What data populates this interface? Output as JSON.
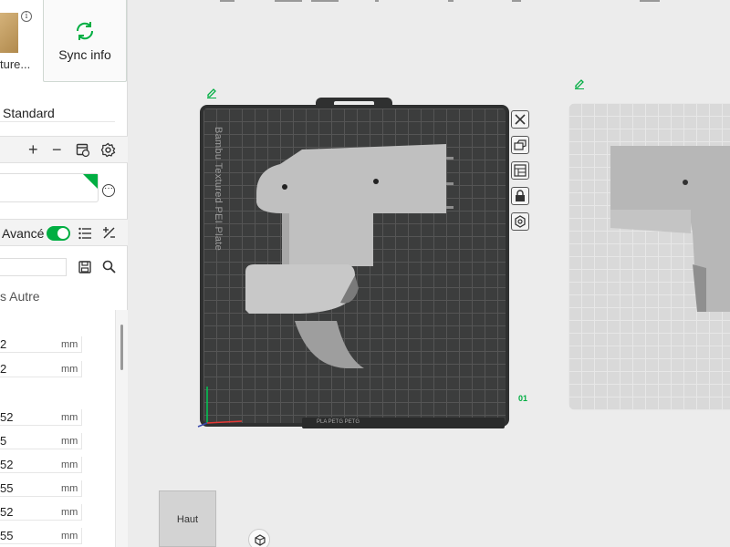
{
  "left_panel": {
    "plate_thumb_label": "ture...",
    "info_icon": "info-icon",
    "sync_button_label": "Sync info",
    "process_preset": "Standard",
    "mode_label": "Avancé",
    "tabs_text": "s   Autre",
    "rows": [
      {
        "value": "2",
        "unit": "mm"
      },
      {
        "value": "2",
        "unit": "mm"
      },
      {
        "value": "52",
        "unit": "mm"
      },
      {
        "value": "5",
        "unit": "mm"
      },
      {
        "value": "52",
        "unit": "mm"
      },
      {
        "value": "55",
        "unit": "mm"
      },
      {
        "value": "52",
        "unit": "mm"
      },
      {
        "value": "55",
        "unit": "mm"
      }
    ]
  },
  "viewport": {
    "plate_name": "Bambu Textured PEI Plate",
    "plate_number": "01",
    "plate_bar_text": "PLA PETG  PETG",
    "view_cube_label": "Haut"
  },
  "colors": {
    "accent": "#00ae42",
    "plate": "#3c3d3d",
    "model": "#bdbdbd"
  }
}
